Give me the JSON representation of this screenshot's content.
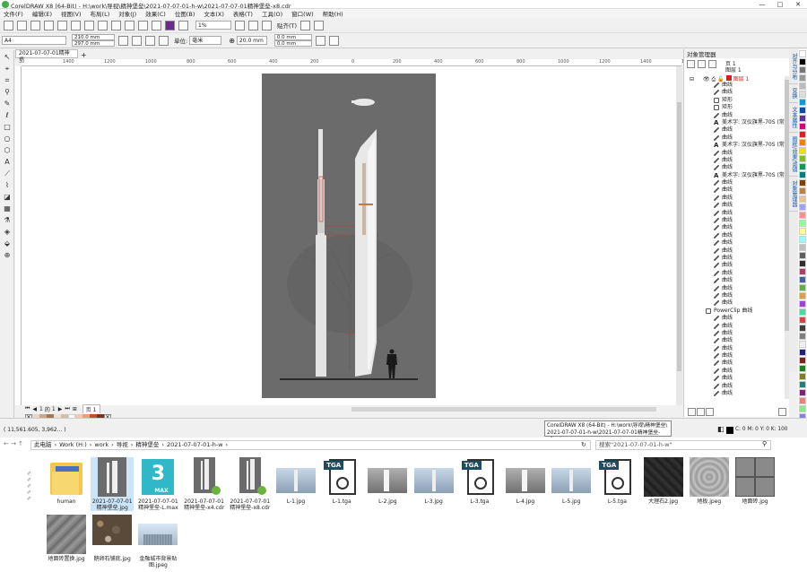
{
  "window": {
    "title": "CorelDRAW X8 (64-Bit) - H:\\work\\导视\\精神堡垒\\2021-07-07-01-h-w\\2021-07-07-01精神堡垒-x8.cdr"
  },
  "menu": [
    "文件(F)",
    "编辑(E)",
    "视图(V)",
    "布局(L)",
    "对象(J)",
    "效果(C)",
    "位图(B)",
    "文本(X)",
    "表格(T)",
    "工具(O)",
    "窗口(W)",
    "帮助(H)"
  ],
  "toolbar1": {
    "zoom": "1%",
    "snap": "贴齐(T)"
  },
  "toolbar2": {
    "paper": "A4",
    "width": "210.0 mm",
    "height": "297.0 mm",
    "units_label": "单位:",
    "units": "毫米",
    "nudge": "20.0 mm",
    "dup_x": "0.0 mm",
    "dup_y": "0.0 mm"
  },
  "document": {
    "tab": "2021-07-07-01精神堡..."
  },
  "ruler": [
    "0",
    "1400",
    "1200",
    "1000",
    "800",
    "600",
    "400",
    "200",
    "0",
    "200",
    "400",
    "600",
    "800",
    "1000",
    "1200",
    "1400",
    "1600"
  ],
  "pagenav": {
    "page_current": "1",
    "page_of": "的",
    "page_total": "1",
    "page_tab": "页 1"
  },
  "object_manager": {
    "title": "对象管理器",
    "page": "页 1",
    "layer": "图层 1",
    "active_layer": "图层 1",
    "items": [
      "曲线",
      "曲线",
      "矩形",
      "矩形",
      "曲线",
      "美术字: 汉仪旗黑-70S (常规...",
      "曲线",
      "曲线",
      "美术字: 汉仪旗黑-70S (常规...",
      "曲线",
      "曲线",
      "曲线",
      "美术字: 汉仪旗黑-70S (常规...",
      "曲线",
      "曲线",
      "曲线",
      "曲线",
      "曲线",
      "曲线",
      "曲线",
      "曲线",
      "曲线",
      "曲线",
      "曲线",
      "曲线",
      "曲线",
      "曲线",
      "曲线",
      "曲线",
      "曲线",
      "PowerClip 曲线",
      "曲线",
      "曲线",
      "曲线",
      "曲线",
      "曲线",
      "曲线",
      "曲线",
      "曲线",
      "曲线",
      "曲线",
      "曲线"
    ]
  },
  "side_tabs": [
    "对齐与分布",
    "变换",
    "文本属性",
    "图框/效果/滤镜",
    "对象管理器"
  ],
  "status": {
    "coords": "( 11,561.605, 3,962... )",
    "fill": "C: 0 M: 0 Y: 0 K: 100"
  },
  "tooltip": {
    "line1": "CorelDRAW X8 (64-Bit) - H:\\work\\导视\\精神堡垒\\",
    "line2": "2021-07-07-01-h-w\\2021-07-07-01精神堡垒-x8.cdr"
  },
  "explorer": {
    "breadcrumb": [
      "此电脑",
      "Work (H:)",
      "work",
      "导视",
      "精神堡垒",
      "2021-07-07-01-h-w"
    ],
    "search_placeholder": "搜索\"2021-07-07-01-h-w\"",
    "files": [
      {
        "name": "human",
        "kind": "folder"
      },
      {
        "name": "2021-07-07-01 精神堡垒.jpg",
        "kind": "tower"
      },
      {
        "name": "2021-07-07-01 精神堡垒-L.max",
        "kind": "max"
      },
      {
        "name": "2021-07-07-01 精神堡垒-x4.cdr",
        "kind": "cdr"
      },
      {
        "name": "2021-07-07-01 精神堡垒-x8.cdr",
        "kind": "cdr"
      },
      {
        "name": "L-1.jpg",
        "kind": "city"
      },
      {
        "name": "L-1.tga",
        "kind": "tga"
      },
      {
        "name": "L-2.jpg",
        "kind": "render"
      },
      {
        "name": "L-3.jpg",
        "kind": "city"
      },
      {
        "name": "L-3.tga",
        "kind": "tga"
      },
      {
        "name": "L-4.jpg",
        "kind": "render"
      },
      {
        "name": "L-5.jpg",
        "kind": "city"
      },
      {
        "name": "L-5.tga",
        "kind": "tga"
      },
      {
        "name": "大理石2.jpg",
        "kind": "dark"
      },
      {
        "name": "地板.jpeg",
        "kind": "stone"
      },
      {
        "name": "地面砖.jpg",
        "kind": "tile"
      },
      {
        "name": "地面砖置换.jpg",
        "kind": "tile2"
      },
      {
        "name": "鹅卵石铺底.jpg",
        "kind": "pebble"
      },
      {
        "name": "金融城市背景贴图.jpeg",
        "kind": "sky"
      }
    ]
  },
  "colors": {
    "accent": "#1a73c8",
    "canvas_gray": "#6b6b6b",
    "active_layer": "#cc2222"
  }
}
